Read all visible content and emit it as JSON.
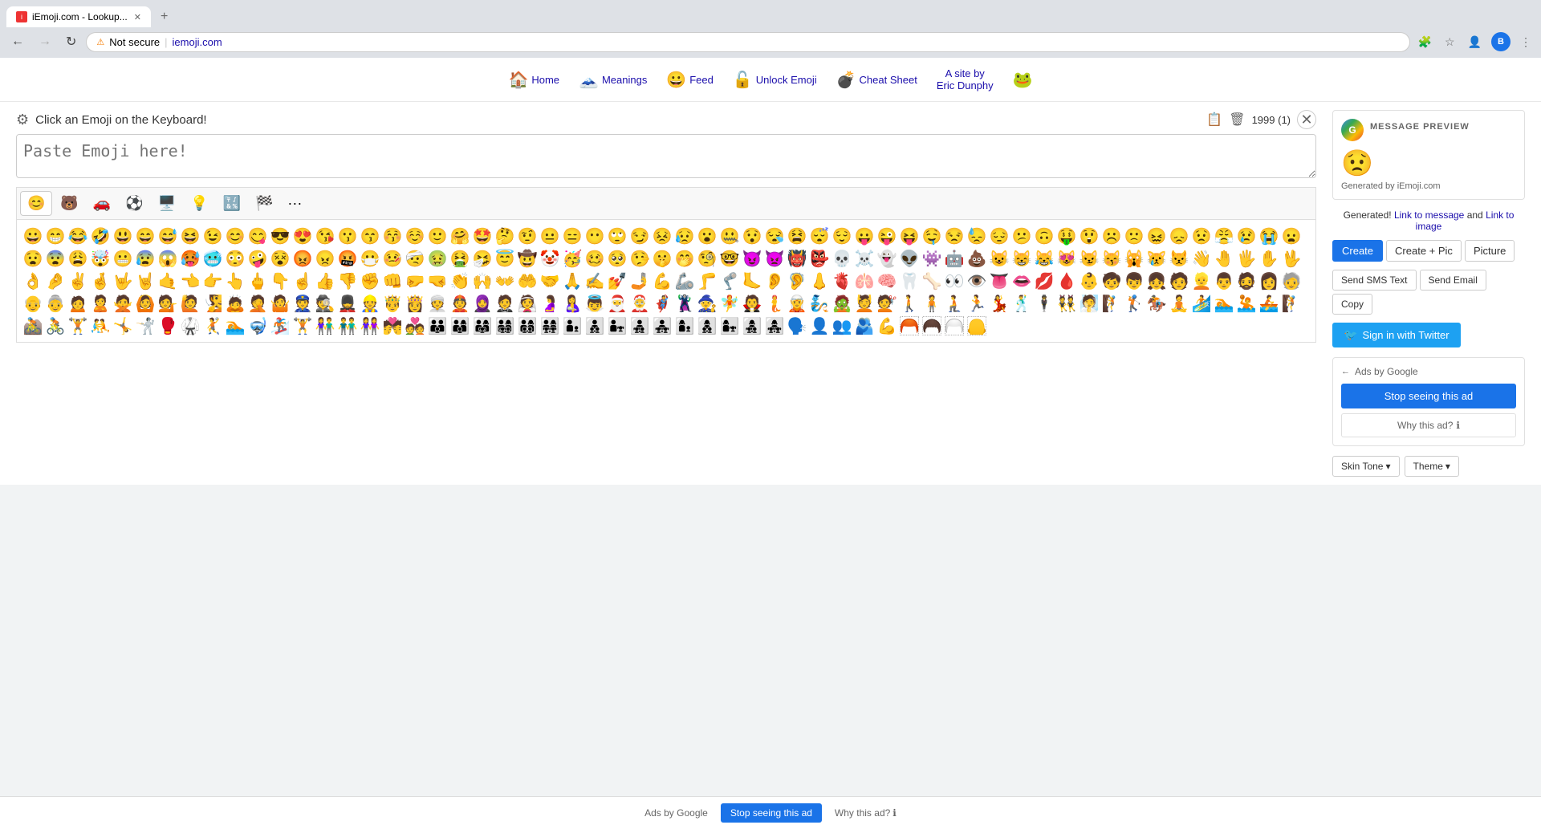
{
  "browser": {
    "tab_title": "iEmoji.com - Lookup...",
    "tab_favicon": "i",
    "address": "iemoji.com",
    "security_label": "Not secure",
    "new_tab_label": "+",
    "nav_back_disabled": false,
    "nav_forward_disabled": true
  },
  "nav": {
    "items": [
      {
        "label": "Home",
        "emoji": "🏠"
      },
      {
        "label": "Meanings",
        "emoji": "🗻"
      },
      {
        "label": "Feed",
        "emoji": "😀"
      },
      {
        "label": "Unlock Emoji",
        "emoji": "🔓"
      },
      {
        "label": "Cheat Sheet",
        "emoji": "💣"
      }
    ],
    "site_by": "A site by\nEric Dunphy",
    "frog_emoji": "🐸"
  },
  "editor": {
    "title": "Click an Emoji on the Keyboard!",
    "textarea_placeholder": "Paste Emoji here!",
    "count_display": "1999 (1)",
    "categories": [
      {
        "emoji": "😊",
        "label": "people"
      },
      {
        "emoji": "🐻",
        "label": "nature"
      },
      {
        "emoji": "🚗",
        "label": "travel"
      },
      {
        "emoji": "⚽",
        "label": "activity"
      },
      {
        "emoji": "🖥️",
        "label": "objects"
      },
      {
        "emoji": "💡",
        "label": "symbols"
      },
      {
        "emoji": "🔣",
        "label": "dingbats"
      },
      {
        "emoji": "🏁",
        "label": "flags"
      },
      {
        "emoji": "···",
        "label": "more"
      }
    ]
  },
  "emojis": [
    "😀",
    "😁",
    "😂",
    "🤣",
    "😃",
    "😄",
    "😅",
    "😆",
    "😉",
    "😊",
    "😋",
    "😎",
    "😍",
    "😘",
    "😗",
    "😙",
    "😚",
    "☺️",
    "🙂",
    "🤗",
    "🤩",
    "🤔",
    "🤨",
    "😐",
    "😑",
    "😶",
    "🙄",
    "😏",
    "😣",
    "😥",
    "😮",
    "🤐",
    "😯",
    "😪",
    "😫",
    "😴",
    "😌",
    "😛",
    "😜",
    "😝",
    "🤤",
    "😒",
    "😓",
    "😔",
    "😕",
    "🙃",
    "🤑",
    "😲",
    "☹️",
    "🙁",
    "😖",
    "😞",
    "😟",
    "😤",
    "😢",
    "😭",
    "😦",
    "😧",
    "😨",
    "😩",
    "🤯",
    "😬",
    "😰",
    "😱",
    "🥵",
    "🥶",
    "😳",
    "🤪",
    "😵",
    "😡",
    "😠",
    "🤬",
    "😷",
    "🤒",
    "🤕",
    "🤢",
    "🤮",
    "🤧",
    "😇",
    "🤠",
    "🤡",
    "🥳",
    "🥴",
    "🥺",
    "🤥",
    "🤫",
    "🤭",
    "🧐",
    "🤓",
    "😈",
    "👿",
    "👹",
    "👺",
    "💀",
    "☠️",
    "👻",
    "👽",
    "👾",
    "🤖",
    "💩",
    "😺",
    "😸",
    "😹",
    "😻",
    "😼",
    "😽",
    "🙀",
    "😿",
    "😾",
    "👋",
    "🤚",
    "🖐️",
    "✋",
    "🖖",
    "👌",
    "🤌",
    "✌️",
    "🤞",
    "🤟",
    "🤘",
    "🤙",
    "👈",
    "👉",
    "👆",
    "🖕",
    "👇",
    "☝️",
    "👍",
    "👎",
    "✊",
    "👊",
    "🤛",
    "🤜",
    "👏",
    "🙌",
    "👐",
    "🤲",
    "🤝",
    "🙏",
    "✍️",
    "💅",
    "🤳",
    "💪",
    "🦾",
    "🦵",
    "🦿",
    "🦶",
    "👂",
    "🦻",
    "👃",
    "🫀",
    "🫁",
    "🧠",
    "🦷",
    "🦴",
    "👀",
    "👁️",
    "👅",
    "👄",
    "💋",
    "🩸",
    "👶",
    "🧒",
    "👦",
    "👧",
    "🧑",
    "👱",
    "👨",
    "🧔",
    "👩",
    "🧓",
    "👴",
    "👵",
    "🙍",
    "🙎",
    "🙅",
    "🙆",
    "💁",
    "🙋",
    "🧏",
    "🙇",
    "🤦",
    "🤷",
    "👮",
    "🕵️",
    "💂",
    "👷",
    "🤴",
    "👸",
    "👳",
    "👲",
    "🧕",
    "🤵",
    "👰",
    "🤰",
    "🤱",
    "👼",
    "🎅",
    "🤶",
    "🦸",
    "🦹",
    "🧙",
    "🧚",
    "🧛",
    "🧜",
    "🧝",
    "🧞",
    "🧟",
    "💆",
    "💇",
    "🚶",
    "🧍",
    "🧎",
    "🏃",
    "💃",
    "🕺",
    "🕴️",
    "👯",
    "🧖",
    "🧗",
    "🏌️",
    "🏇",
    "🧘",
    "🏄",
    "🏊",
    "🤽",
    "🚣",
    "🧗",
    "🚵",
    "🚴",
    "🏋️",
    "🤼",
    "🤸",
    "🤺",
    "🥊",
    "🥋",
    "🤾",
    "🏊",
    "🤿",
    "🏂",
    "🏋️",
    "👫",
    "👬",
    "👭",
    "💏",
    "💑",
    "👪",
    "👨‍👩‍👦",
    "👨‍👩‍👧",
    "👨‍👩‍👧‍👦",
    "👨‍👩‍👦‍👦",
    "👨‍👩‍👧‍👧",
    "👨‍👦",
    "👨‍👦‍👦",
    "👨‍👧",
    "👨‍👧‍👦",
    "👨‍👧‍👧",
    "👩‍👦",
    "👩‍👦‍👦",
    "👩‍👧",
    "👩‍👧‍👦",
    "👩‍👧‍👧",
    "🗣️",
    "👤",
    "👥",
    "🫂",
    "💪",
    "🦰",
    "🦱",
    "🦳",
    "🦲"
  ],
  "right_panel": {
    "message_preview_label": "MESSAGE PREVIEW",
    "preview_emoji": "😟",
    "generated_by": "Generated by iEmoji.com",
    "generated_text": "Generated!",
    "link_to_message": "Link to message",
    "and_text": "and",
    "link_to_image": "Link to image",
    "btn_create": "Create",
    "btn_create_pic": "Create + Pic",
    "btn_picture": "Picture",
    "btn_sms": "Send SMS Text",
    "btn_email": "Send Email",
    "btn_copy": "Copy",
    "btn_twitter": "Sign in with Twitter",
    "ads_label": "Ads by Google",
    "btn_stop_ad": "Stop seeing this ad",
    "btn_why_ad": "Why this ad?",
    "btn_skin_tone": "Skin Tone",
    "btn_theme": "Theme"
  },
  "bottom_ad": {
    "label": "Ads by Google",
    "btn_stop": "Stop seeing this ad",
    "btn_why": "Why this ad?"
  }
}
